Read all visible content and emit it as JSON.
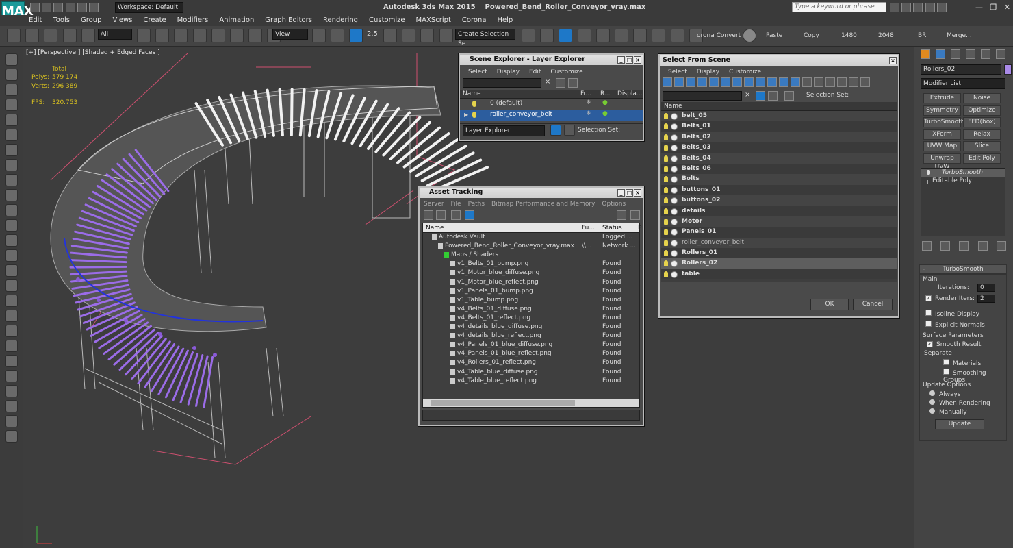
{
  "app": {
    "title": "Autodesk 3ds Max  2015",
    "file": "Powered_Bend_Roller_Conveyor_vray.max",
    "workspace": "Workspace: Default",
    "search_placeholder": "Type a keyword or phrase",
    "logo": "MAX"
  },
  "menu": [
    "Edit",
    "Tools",
    "Group",
    "Views",
    "Create",
    "Modifiers",
    "Animation",
    "Graph Editors",
    "Rendering",
    "Customize",
    "MAXScript",
    "Corona",
    "Help"
  ],
  "toolbar": {
    "filter": "All",
    "ref_coord": "View",
    "selection_set": "Create Selection Se",
    "snap_value": "2.5",
    "corona_convert": "orona Convert",
    "paste": "Paste",
    "copy": "Copy",
    "w": "1480",
    "h": "2048",
    "br": "BR",
    "merge": "Merge..."
  },
  "viewport": {
    "label": "[+] [Perspective ] [Shaded + Edged Faces ]",
    "stats": {
      "total_label": "Total",
      "polys_label": "Polys:",
      "polys": "579 174",
      "verts_label": "Verts:",
      "verts": "296 389",
      "fps_label": "FPS:",
      "fps": "320.753"
    }
  },
  "scene_explorer": {
    "title": "Scene Explorer - Layer Explorer",
    "menu": [
      "Select",
      "Display",
      "Edit",
      "Customize"
    ],
    "cols": [
      "Name",
      "Fr...",
      "R...",
      "Displa..."
    ],
    "rows": [
      "0 (default)",
      "roller_conveyor_belt"
    ],
    "footer_dd": "Layer Explorer",
    "footer_sel": "Selection Set:"
  },
  "asset_tracking": {
    "title": "Asset Tracking",
    "menu": [
      "Server",
      "File",
      "Paths",
      "Bitmap Performance and Memory",
      "Options"
    ],
    "cols": [
      "Name",
      "Fu...",
      "Status",
      "P"
    ],
    "rows": [
      {
        "name": "Autodesk Vault",
        "fu": "",
        "status": "Logged ...",
        "indent": 1
      },
      {
        "name": "Powered_Bend_Roller_Conveyor_vray.max",
        "fu": "\\\\...",
        "status": "Network ...",
        "indent": 2
      },
      {
        "name": "Maps / Shaders",
        "fu": "",
        "status": "",
        "indent": 3
      },
      {
        "name": "v1_Belts_01_bump.png",
        "fu": "",
        "status": "Found",
        "indent": 4
      },
      {
        "name": "v1_Motor_blue_diffuse.png",
        "fu": "",
        "status": "Found",
        "indent": 4
      },
      {
        "name": "v1_Motor_blue_reflect.png",
        "fu": "",
        "status": "Found",
        "indent": 4
      },
      {
        "name": "v1_Panels_01_bump.png",
        "fu": "",
        "status": "Found",
        "indent": 4
      },
      {
        "name": "v1_Table_bump.png",
        "fu": "",
        "status": "Found",
        "indent": 4
      },
      {
        "name": "v4_Belts_01_diffuse.png",
        "fu": "",
        "status": "Found",
        "indent": 4
      },
      {
        "name": "v4_Belts_01_reflect.png",
        "fu": "",
        "status": "Found",
        "indent": 4
      },
      {
        "name": "v4_details_blue_diffuse.png",
        "fu": "",
        "status": "Found",
        "indent": 4
      },
      {
        "name": "v4_details_blue_reflect.png",
        "fu": "",
        "status": "Found",
        "indent": 4
      },
      {
        "name": "v4_Panels_01_blue_diffuse.png",
        "fu": "",
        "status": "Found",
        "indent": 4
      },
      {
        "name": "v4_Panels_01_blue_reflect.png",
        "fu": "",
        "status": "Found",
        "indent": 4
      },
      {
        "name": "v4_Rollers_01_reflect.png",
        "fu": "",
        "status": "Found",
        "indent": 4
      },
      {
        "name": "v4_Table_blue_diffuse.png",
        "fu": "",
        "status": "Found",
        "indent": 4
      },
      {
        "name": "v4_Table_blue_reflect.png",
        "fu": "",
        "status": "Found",
        "indent": 4
      }
    ]
  },
  "select_from_scene": {
    "title": "Select From Scene",
    "menu": [
      "Select",
      "Display",
      "Customize"
    ],
    "selection_set": "Selection Set:",
    "col": "Name",
    "items": [
      "belt_05",
      "Belts_01",
      "Belts_02",
      "Belts_03",
      "Belts_04",
      "Belts_06",
      "Bolts",
      "buttons_01",
      "buttons_02",
      "details",
      "Motor",
      "Panels_01",
      "roller_conveyor_belt",
      "Rollers_01",
      "Rollers_02",
      "table"
    ],
    "ok": "OK",
    "cancel": "Cancel"
  },
  "command_panel": {
    "object_name": "Rollers_02",
    "modifier_list": "Modifier List",
    "buttons": [
      "Extrude",
      "Noise",
      "Symmetry",
      "Optimize",
      "TurboSmooth",
      "FFD(box)",
      "XForm",
      "Relax",
      "UVW Map",
      "Slice",
      "Unwrap UVW",
      "Edit Poly"
    ],
    "stack": [
      "TurboSmooth",
      "Editable Poly"
    ],
    "rollout_title": "TurboSmooth",
    "main_label": "Main",
    "iterations_label": "Iterations:",
    "iterations": "0",
    "render_iters_label": "Render Iters:",
    "render_iters": "2",
    "isoline": "Isoline Display",
    "explicit_normals": "Explicit Normals",
    "surface_params": "Surface Parameters",
    "smooth_result": "Smooth Result",
    "separate": "Separate",
    "materials": "Materials",
    "smoothing_groups": "Smoothing Groups",
    "update_options": "Update Options",
    "always": "Always",
    "when_rendering": "When Rendering",
    "manually": "Manually",
    "update": "Update"
  }
}
